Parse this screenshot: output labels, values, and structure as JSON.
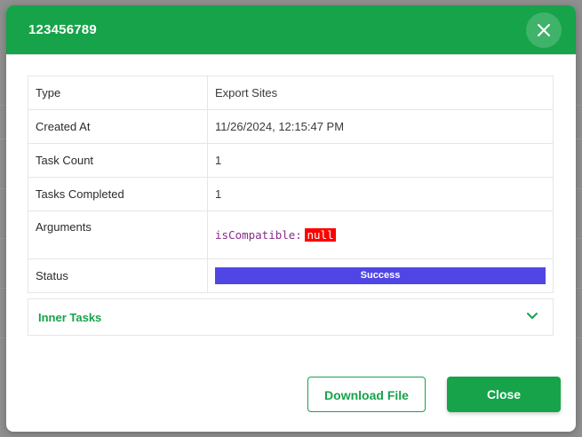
{
  "modal": {
    "title": "123456789"
  },
  "details": {
    "type": {
      "label": "Type",
      "value": "Export Sites"
    },
    "created_at": {
      "label": "Created At",
      "value": "11/26/2024, 12:15:47 PM"
    },
    "task_count": {
      "label": "Task Count",
      "value": "1"
    },
    "tasks_completed": {
      "label": "Tasks Completed",
      "value": "1"
    },
    "arguments": {
      "label": "Arguments",
      "code_key": "isCompatible:",
      "code_value": "null"
    },
    "status": {
      "label": "Status",
      "value": "Success"
    }
  },
  "accordion": {
    "label": "Inner Tasks"
  },
  "footer": {
    "download_label": "Download File",
    "close_label": "Close"
  },
  "colors": {
    "primary": "#16a34a",
    "status_success": "#4f46e5",
    "null_highlight": "#ff0000"
  },
  "icons": {
    "close": "close-icon",
    "chevron": "chevron-down-icon"
  }
}
